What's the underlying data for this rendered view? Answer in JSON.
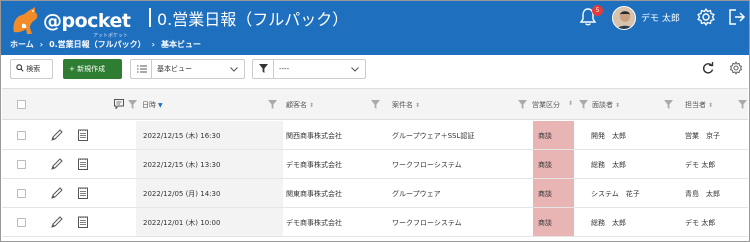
{
  "app": {
    "logo_text": "@pocket",
    "logo_sub": "アットポケット",
    "title": "0.営業日報（フルパック）"
  },
  "breadcrumb": [
    "ホーム",
    "0.営業日報（フルパック）",
    "基本ビュー"
  ],
  "header": {
    "notification_count": "5",
    "user_name": "デモ 太郎"
  },
  "toolbar": {
    "search_label": "検索",
    "new_label": "+ 新規作成",
    "view_value": "基本ビュー",
    "filter_value": "----"
  },
  "columns": {
    "date": "日時",
    "company": "顧客名",
    "case": "案件名",
    "type": "営業区分",
    "visitor": "面談者",
    "owner": "担当者"
  },
  "rows": [
    {
      "date": "2022/12/15 (木) 16:30",
      "company": "関西商事株式会社",
      "case": "グループウェア＋SSL認証",
      "type": "商談",
      "visitor": "開発　太郎",
      "owner": "営業　京子"
    },
    {
      "date": "2022/12/15 (木) 13:30",
      "company": "デモ商事株式会社",
      "case": "ワークフローシステム",
      "type": "商談",
      "visitor": "総務　太郎",
      "owner": "デモ 太郎"
    },
    {
      "date": "2022/12/05 (月) 14:30",
      "company": "関東商事株式会社",
      "case": "グループウェア",
      "type": "商談",
      "visitor": "システム　花子",
      "owner": "青島　太郎"
    },
    {
      "date": "2022/12/01 (木) 10:00",
      "company": "デモ商事株式会社",
      "case": "ワークフローシステム",
      "type": "商談",
      "visitor": "総務　太郎",
      "owner": "デモ 太郎"
    }
  ],
  "colors": {
    "header_bg": "#1f6fbf",
    "new_button": "#2e7d32",
    "status_bg": "#e8b4b4"
  }
}
